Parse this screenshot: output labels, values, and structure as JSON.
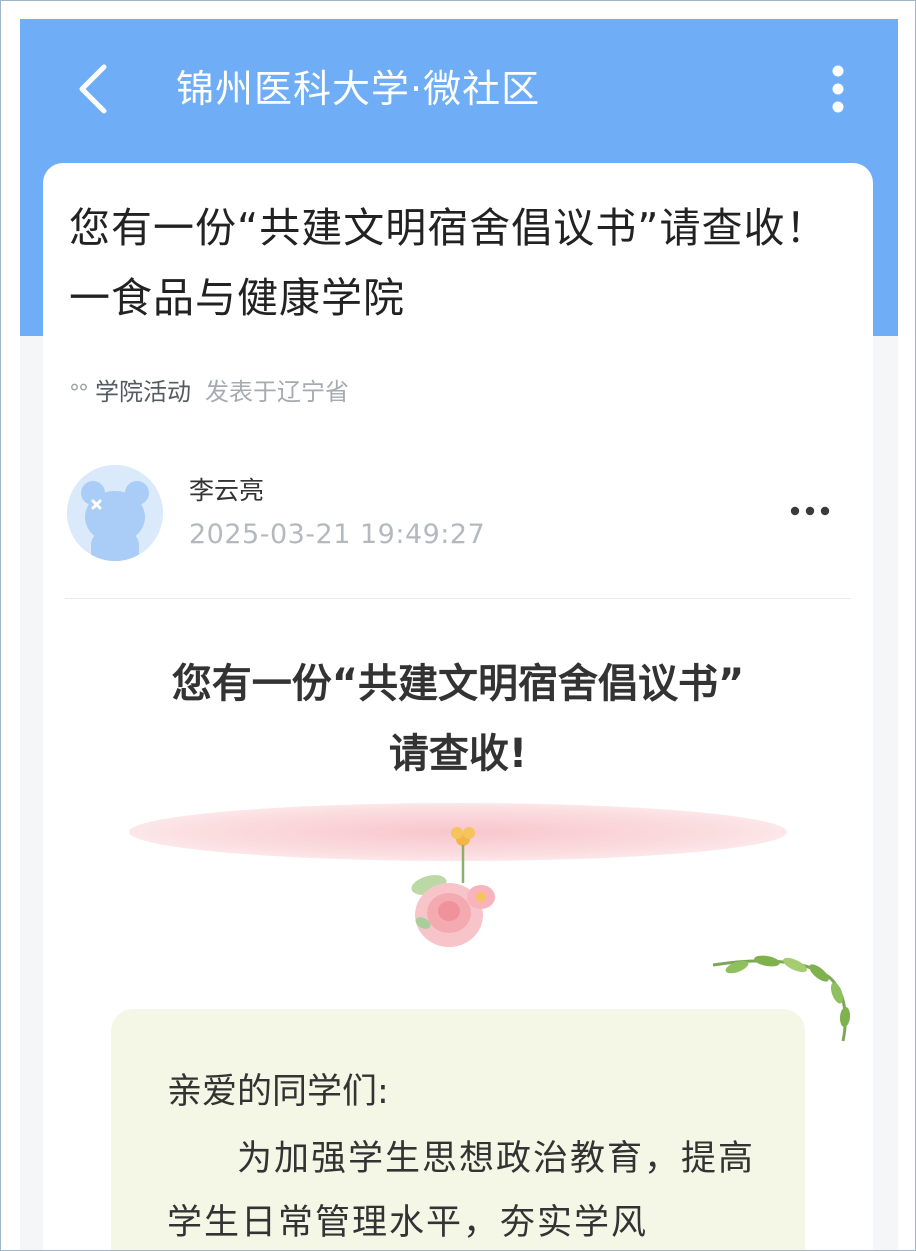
{
  "nav": {
    "title": "锦州医科大学·微社区",
    "back_icon": "chevron-left-icon",
    "more_icon": "more-vertical-icon"
  },
  "post": {
    "title": "您有一份“共建文明宿舍倡议书”请查收！一食品与健康学院",
    "category": "学院活动",
    "location": "发表于辽宁省",
    "author": "李云亮",
    "time": "2025-03-21 19:49:27"
  },
  "article": {
    "heading_line1": "您有一份“共建文明宿舍倡议书”",
    "heading_line2": "请查收!",
    "greeting": "亲爱的同学们:",
    "body": "为加强学生思想政治教育，提高学生日常管理水平，夯实学风"
  },
  "colors": {
    "header_blue": "#6fadf6",
    "letter_background": "#f4f7e6",
    "pink_accent": "#f8c6cc"
  }
}
